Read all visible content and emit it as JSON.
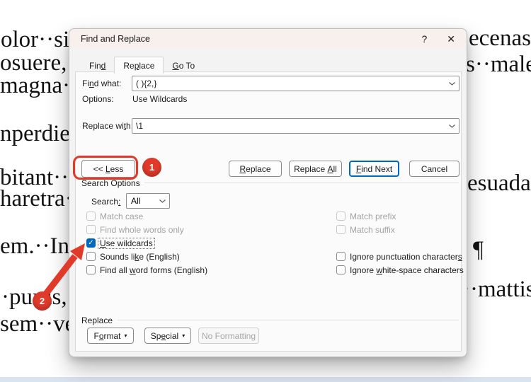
{
  "background": {
    "left_lines": [
      {
        "text": "olor··sit·"
      },
      {
        "text": "osuere,··"
      },
      {
        "text": "magna··"
      },
      {
        "text": "nperdiet"
      },
      {
        "text": "bitant··n"
      },
      {
        "text": "haretra··"
      },
      {
        "text": "em.··In·"
      },
      {
        "text": "·purus,·"
      },
      {
        "text": "sem··ver"
      }
    ],
    "right_lines": [
      {
        "text": "ecenas·"
      },
      {
        "text": "s··male"
      },
      {
        "text": "esuada·"
      },
      {
        "text": "¶"
      },
      {
        "text": "··mattis"
      }
    ]
  },
  "dialog": {
    "title": "Find and Replace",
    "tabs": {
      "find": {
        "pre": "Fin",
        "key": "d",
        "post": ""
      },
      "replace": {
        "pre": "Re",
        "key": "p",
        "post": "lace"
      },
      "goto": {
        "pre": "",
        "key": "G",
        "post": "o To"
      }
    },
    "find_what": {
      "label": {
        "pre": "Fi",
        "key": "n",
        "post": "d what:"
      },
      "value": "( ){2,}"
    },
    "options_row": {
      "label": "Options:",
      "value": "Use Wildcards"
    },
    "replace_with": {
      "label": {
        "pre": "Replace wi",
        "key": "t",
        "post": "h:"
      },
      "value": "\\1"
    },
    "buttons": {
      "less": {
        "pre": "<< ",
        "key": "L",
        "post": "ess"
      },
      "replace": {
        "pre": "",
        "key": "R",
        "post": "eplace"
      },
      "replace_all": {
        "pre": "Replace ",
        "key": "A",
        "post": "ll"
      },
      "find_next": {
        "pre": "",
        "key": "F",
        "post": "ind Next"
      },
      "cancel": "Cancel"
    },
    "search_options": {
      "group_label": "Search Options",
      "search_label": {
        "pre": "Search",
        "key": ":",
        "post": ""
      },
      "search_value": "All",
      "match_case": "Match case",
      "whole_words": "Find whole words only",
      "use_wildcards": {
        "pre": "",
        "key": "U",
        "post": "se wildcards"
      },
      "sounds_like": {
        "pre": "Sounds li",
        "key": "k",
        "post": "e (English)"
      },
      "word_forms": {
        "pre": "Find all ",
        "key": "w",
        "post": "ord forms (English)"
      },
      "match_prefix": "Match prefix",
      "match_suffix": "Match suffix",
      "ignore_punct": {
        "pre": "Ignore punctuation character",
        "key": "s",
        "post": ""
      },
      "ignore_space": {
        "pre": "Ignore ",
        "key": "w",
        "post": "hite-space characters"
      }
    },
    "replace_group": {
      "group_label": "Replace",
      "format": {
        "pre": "F",
        "key": "o",
        "post": "rmat"
      },
      "special": {
        "pre": "Sp",
        "key": "e",
        "post": "cial"
      },
      "no_formatting": "No Formatting"
    }
  },
  "icons": {
    "help": "?",
    "close": "✕",
    "check": "✓",
    "menu_arrow": "▾"
  },
  "annotations": {
    "step1": "1",
    "step2": "2"
  },
  "colors": {
    "accent_blue": "#0067c0",
    "annotation_red": "#e03a2b",
    "title_bar_bg": "#f8f0ed",
    "checked_checkbox": "#0067c0"
  }
}
